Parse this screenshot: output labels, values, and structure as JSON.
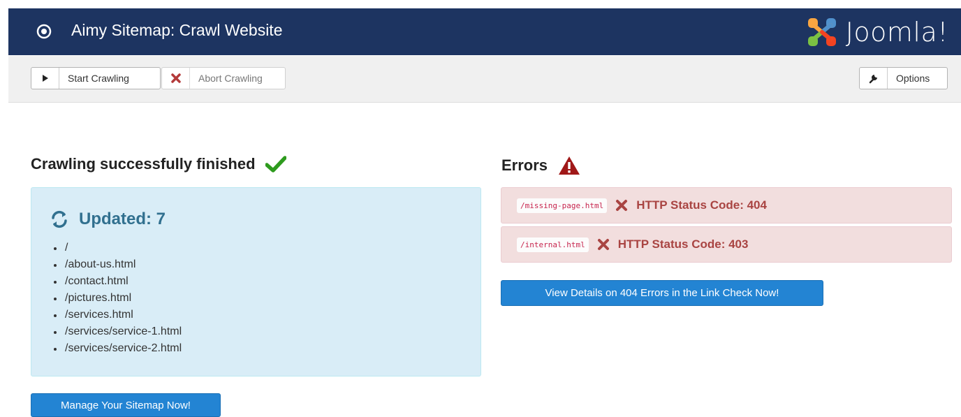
{
  "header": {
    "title": "Aimy Sitemap: Crawl Website",
    "logo_text": "Joomla!",
    "bg_color": "#1d3461"
  },
  "toolbar": {
    "start_label": "Start Crawling",
    "abort_label": "Abort Crawling",
    "options_label": "Options"
  },
  "left": {
    "heading": "Crawling successfully finished",
    "updated_title": "Updated: 7",
    "updated_items": [
      "/",
      "/about-us.html",
      "/contact.html",
      "/pictures.html",
      "/services.html",
      "/services/service-1.html",
      "/services/service-2.html"
    ],
    "manage_button": "Manage Your Sitemap Now!"
  },
  "right": {
    "heading": "Errors",
    "errors": [
      {
        "path": "/missing-page.html",
        "status": "HTTP Status Code: 404"
      },
      {
        "path": "/internal.html",
        "status": "HTTP Status Code: 403"
      }
    ],
    "details_button": "View Details on 404 Errors in the Link Check Now!"
  },
  "colors": {
    "success": "#2e9b1e",
    "danger": "#a01818",
    "info_bg": "#d9edf7",
    "error_bg": "#f2dede",
    "primary": "#2384d3"
  }
}
